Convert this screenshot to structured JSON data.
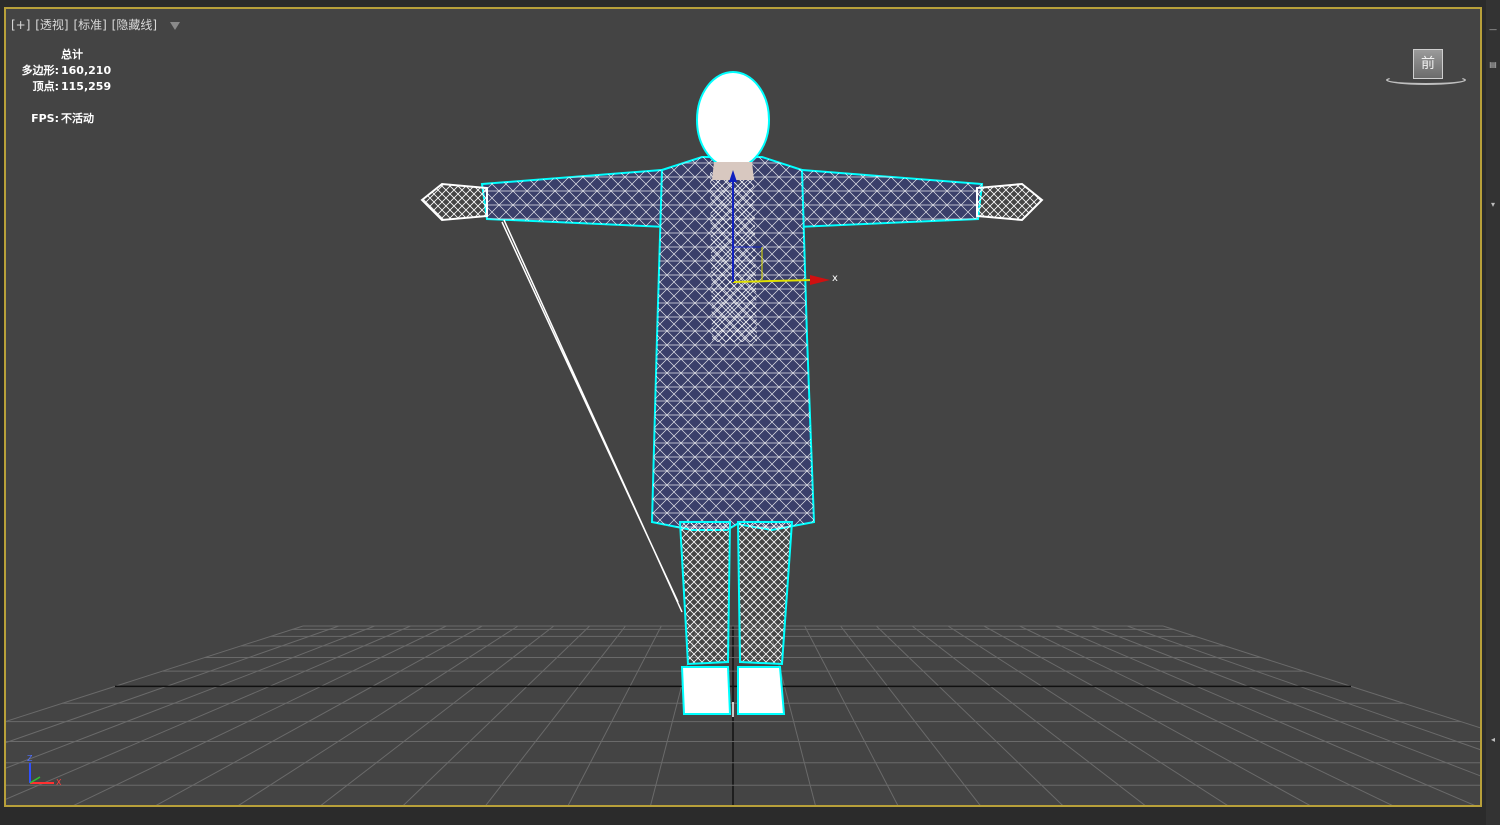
{
  "viewport": {
    "label_parts": [
      "[+]",
      "[透视]",
      "[标准]",
      "[隐藏线]"
    ],
    "filter_icon": "filter-funnel-icon",
    "border_color": "#b8a03a",
    "background": "#444444"
  },
  "stats": {
    "header": "总计",
    "polygons_label": "多边形:",
    "polygons_value": "160,210",
    "vertices_label": "顶点:",
    "vertices_value": "115,259",
    "fps_label": "FPS:",
    "fps_value": "不活动"
  },
  "viewcube": {
    "face_label": "前"
  },
  "gizmo": {
    "x_label": "x"
  },
  "axis_tripod": {
    "z_label": "Z",
    "x_label": "X"
  },
  "colors": {
    "wire": "#ffffff",
    "selection": "#00ffff",
    "coat": "#3a3f6a",
    "grid": "#6a6a6a",
    "grid_axis": "#111111",
    "gizmo_x": "#d01010",
    "gizmo_y": "#e0e000",
    "gizmo_z": "#1020c0"
  }
}
